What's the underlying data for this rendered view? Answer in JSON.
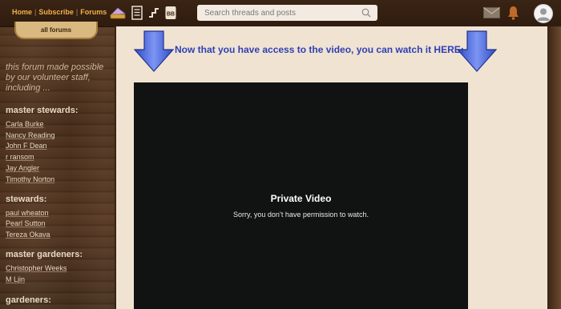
{
  "topbar": {
    "nav": [
      "Home",
      "Subscribe",
      "Forums"
    ],
    "search_placeholder": "Search threads and posts",
    "icons": [
      "pie-icon",
      "document-icon",
      "steps-icon",
      "bb-icon",
      "mail-icon",
      "bell-icon"
    ]
  },
  "sidebar": {
    "all_forums": "all forums",
    "intro": "this forum made possible by our volunteer staff, including ...",
    "groups": [
      {
        "title": "master stewards:",
        "members": [
          "Carla Burke",
          "Nancy Reading",
          "John F Dean",
          "r ransom",
          "Jay Angler",
          "Timothy Norton"
        ]
      },
      {
        "title": "stewards:",
        "members": [
          "paul wheaton",
          "Pearl Sutton",
          "Tereza Okava"
        ]
      },
      {
        "title": "master gardeners:",
        "members": [
          "Christopher Weeks",
          "M Ljin"
        ]
      },
      {
        "title": "gardeners:",
        "members": []
      }
    ]
  },
  "main": {
    "heading": "Now that you have access to the video, you can watch it HERE:",
    "video": {
      "title": "Private Video",
      "message": "Sorry, you don’t have permission to watch."
    }
  },
  "colors": {
    "accent": "#f0b14a",
    "heading": "#2f3fb5",
    "arrow": "#4a64e0",
    "panel": "#f0e3d2"
  }
}
